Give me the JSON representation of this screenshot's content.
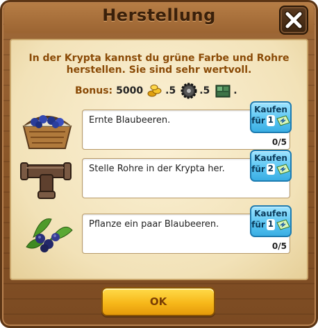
{
  "dialog": {
    "title": "Herstellung",
    "intro": "In der Krypta kannst du grüne Farbe und Rohre herstellen. Sie sind sehr wertvoll.",
    "bonus": {
      "label": "Bonus:",
      "amount": "5000",
      "items": [
        {
          "icon": "gold-coins-icon",
          "count": ".5"
        },
        {
          "icon": "gear-icon",
          "count": ".5"
        },
        {
          "icon": "crate-icon",
          "count": "."
        }
      ]
    },
    "tasks": [
      {
        "icon": "blueberry-basket-icon",
        "text": "Ernte Blaubeeren.",
        "progress": "0/5",
        "buy_label": "Kaufen",
        "buy_prefix": "für",
        "buy_cost": "1",
        "currency_icon": "ticket-icon"
      },
      {
        "icon": "pipe-icon",
        "text": "Stelle Rohre in der Krypta her.",
        "progress": "",
        "buy_label": "Kaufen",
        "buy_prefix": "für",
        "buy_cost": "2",
        "currency_icon": "ticket-icon"
      },
      {
        "icon": "blueberry-plant-icon",
        "text": "Pflanze ein paar Blaubeeren.",
        "progress": "0/5",
        "buy_label": "Kaufen",
        "buy_prefix": "für",
        "buy_cost": "1",
        "currency_icon": "ticket-icon"
      }
    ],
    "ok_label": "OK",
    "colors": {
      "accent_text": "#8a4a06",
      "buy_button": "#5cc6f3",
      "ok_button": "#f7b81a"
    }
  }
}
